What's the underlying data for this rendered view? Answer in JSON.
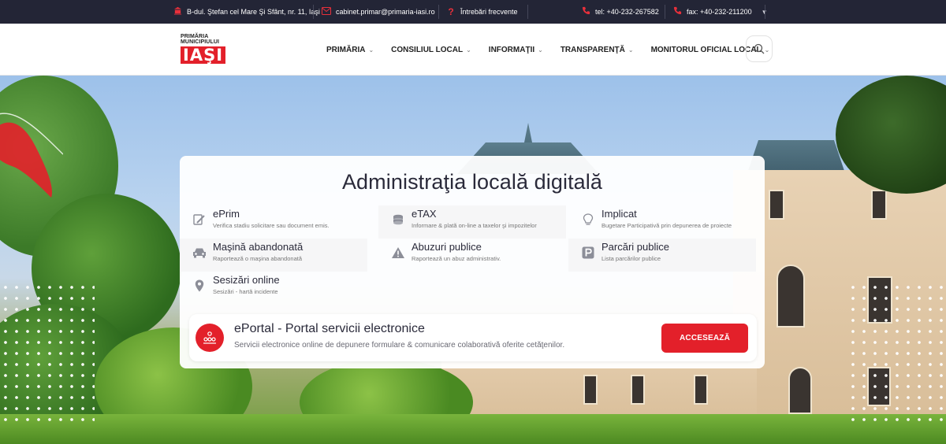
{
  "topbar": {
    "address": "B-dul. Ştefan cel Mare Şi Sfânt, nr. 11, Iaşi",
    "email": "cabinet.primar@primaria-iasi.ro",
    "faq": "Întrebări frecvente",
    "phone": "tel: +40-232-267582",
    "fax": "fax: +40-232-211200"
  },
  "logo": {
    "line1": "PRIMĂRIA",
    "line2": "MUNICIPIULUI",
    "line3": "IAŞI"
  },
  "nav": [
    {
      "label": "PRIMĂRIA"
    },
    {
      "label": "CONSILIUL LOCAL"
    },
    {
      "label": "INFORMAŢII"
    },
    {
      "label": "TRANSPARENŢĂ"
    },
    {
      "label": "MONITORUL OFICIAL LOCAL"
    }
  ],
  "card": {
    "title": "Administraţia locală digitală",
    "services": [
      {
        "title": "ePrim",
        "desc": "Verifica stadiu solicitare sau document emis.",
        "icon": "edit-document-icon"
      },
      {
        "title": "eTAX",
        "desc": "Informare & plată on-line a taxelor şi impozitelor",
        "icon": "coins-icon"
      },
      {
        "title": "Implicat",
        "desc": "Bugetare Participativă prin depunerea de proiecte",
        "icon": "lightbulb-icon"
      },
      {
        "title": "Maşină abandonată",
        "desc": "Raportează o maşina abandonată",
        "icon": "car-icon"
      },
      {
        "title": "Abuzuri publice",
        "desc": "Raportează un abuz administrativ.",
        "icon": "warning-icon"
      },
      {
        "title": "Parcări publice",
        "desc": "Lista parcărilor publice",
        "icon": "parking-icon"
      },
      {
        "title": "Sesizări online",
        "desc": "Sesizări - hartă incidente",
        "icon": "map-pin-icon"
      }
    ]
  },
  "eportal": {
    "title": "ePortal - Portal servicii electronice",
    "desc": "Servicii electronice online de depunere formulare & comunicare colaborativă oferite cetăţenilor.",
    "button": "ACCESEAZĂ"
  },
  "colors": {
    "brand_red": "#e3202a",
    "topbar_bg": "#232536"
  }
}
